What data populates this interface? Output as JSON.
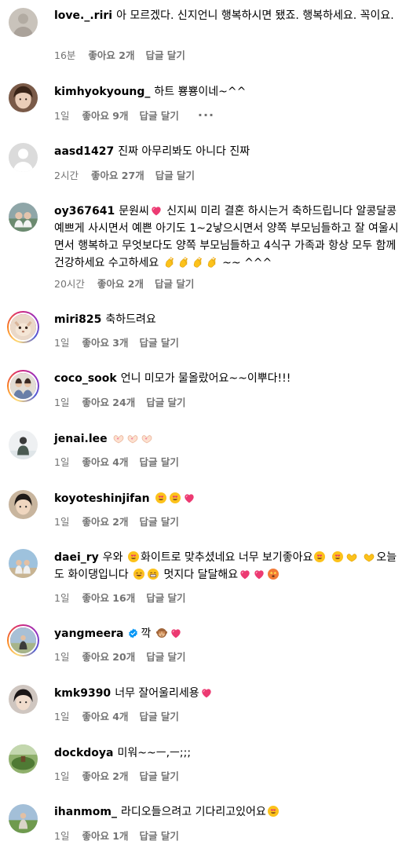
{
  "comments": [
    {
      "username": "love._.riri",
      "text": "아 모르겠다. 신지언니 행복하시면 됐죠. 행복하세요. 꼭이요.",
      "time": "16분",
      "likes": "좋아요 2개",
      "reply": "답글 달기"
    },
    {
      "username": "kimhyokyoung_",
      "text": "하트 뿅뿅이네~^^",
      "time": "1일",
      "likes": "좋아요 9개",
      "reply": "답글 달기",
      "more": "···"
    },
    {
      "username": "aasd1427",
      "text": "진짜 아무리봐도 아니다 진짜",
      "time": "2시간",
      "likes": "좋아요 27개",
      "reply": "답글 달기"
    },
    {
      "username": "oy367641",
      "text_a": "문원씨",
      "text_b": "신지씨 미리 결혼 하시는거 축하드립니다 알콩달콩 예쁘게 사시면서 예쁜 아기도 1~2낳으시면서 양쪽 부모님들하고 잘 여울시면서 행복하고 무엇보다도 양쪽 부모님들하고 4식구 가족과 항상 모두 함께 건강하세요 수고하세요",
      "text_c": "~~ ^^^",
      "time": "20시간",
      "likes": "좋아요 2개",
      "reply": "답글 달기"
    },
    {
      "username": "miri825",
      "text": "축하드려요",
      "time": "1일",
      "likes": "좋아요 3개",
      "reply": "답글 달기"
    },
    {
      "username": "coco_sook",
      "text": "언니 미모가 물올랐어요~~이뿌다!!!",
      "time": "1일",
      "likes": "좋아요 24개",
      "reply": "답글 달기"
    },
    {
      "username": "jenai.lee",
      "text": "",
      "time": "1일",
      "likes": "좋아요 4개",
      "reply": "답글 달기"
    },
    {
      "username": "koyoteshinjifan",
      "text": "",
      "time": "1일",
      "likes": "좋아요 2개",
      "reply": "답글 달기"
    },
    {
      "username": "daei_ry",
      "text_a": "우와",
      "text_b": "화이트로 맞추셨네요 너무 보기좋아요",
      "text_c": "오늘도 화이댕입니다",
      "text_d": "멋지다 달달해요",
      "time": "1일",
      "likes": "좋아요 16개",
      "reply": "답글 달기"
    },
    {
      "username": "yangmeera",
      "text": "깍",
      "time": "1일",
      "likes": "좋아요 20개",
      "reply": "답글 달기"
    },
    {
      "username": "kmk9390",
      "text": "너무 잘어울리세용",
      "time": "1일",
      "likes": "좋아요 4개",
      "reply": "답글 달기"
    },
    {
      "username": "dockdoya",
      "text": "미워~~ㅡ,ㅡ;;;",
      "time": "1일",
      "likes": "좋아요 2개",
      "reply": "답글 달기"
    },
    {
      "username": "ihanmom_",
      "text": "라디오들으려고 기다리고있어요",
      "time": "1일",
      "likes": "좋아요 1개",
      "reply": "답글 달기"
    }
  ],
  "colors": {
    "meta": "#737373",
    "heart": "#e8336e",
    "verified": "#0095f6"
  }
}
